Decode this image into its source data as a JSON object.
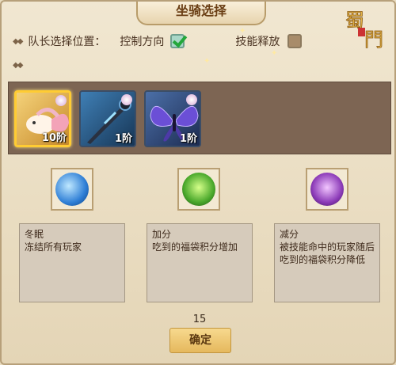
{
  "title": "坐骑选择",
  "captain": {
    "label": "队长选择位置：",
    "option1": "控制方向",
    "option1_checked": true,
    "option2": "技能释放",
    "option2_checked": false
  },
  "mounts": [
    {
      "level": "10阶",
      "icon": "goldfish-mount-icon",
      "selected": true
    },
    {
      "level": "1阶",
      "icon": "sword-mount-icon",
      "selected": false
    },
    {
      "level": "1阶",
      "icon": "butterfly-mount-icon",
      "selected": false
    }
  ],
  "skills": [
    {
      "icon": "ice-crystal-icon",
      "color": "#2f7fd6",
      "name": "冬眠",
      "desc": "冻结所有玩家"
    },
    {
      "icon": "green-cauldron-icon",
      "color": "#4aa82b",
      "name": "加分",
      "desc": "吃到的福袋积分增加"
    },
    {
      "icon": "purple-cauldron-icon",
      "color": "#8c3bb8",
      "name": "减分",
      "desc": "被技能命中的玩家随后吃到的福袋积分降低"
    }
  ],
  "count": "15",
  "confirm": "确定"
}
